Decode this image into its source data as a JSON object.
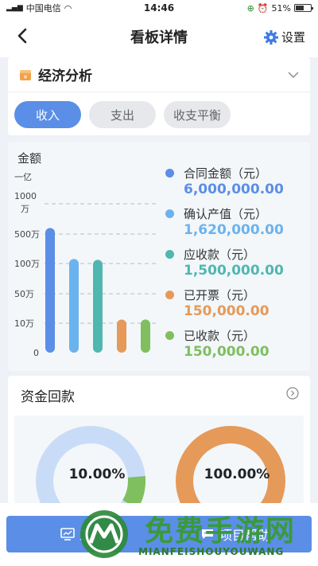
{
  "status": {
    "carrier": "中国电信",
    "time": "14:46",
    "battery": "51%"
  },
  "nav": {
    "title": "看板详情",
    "settings_label": "设置"
  },
  "economic": {
    "title": "经济分析",
    "tabs": [
      {
        "label": "收入",
        "active": true
      },
      {
        "label": "支出",
        "active": false
      },
      {
        "label": "收支平衡",
        "active": false
      }
    ]
  },
  "chart_data": {
    "type": "bar",
    "ylabel": "金额",
    "y_ticks": [
      "一亿",
      "1000万",
      "500万",
      "100万",
      "50万",
      "10万",
      "0"
    ],
    "categories": [
      "合同金额（元）",
      "确认产值（元）",
      "应收款（元）",
      "已开票（元）",
      "已收款（元）"
    ],
    "values": [
      6000000,
      1620000,
      1500000,
      150000,
      150000
    ],
    "value_labels": [
      "6,000,000.00",
      "1,620,000.00",
      "1,500,000.00",
      "150,000.00",
      "150,000.00"
    ],
    "colors": [
      "#5b8ee6",
      "#6bb3ee",
      "#4fb7b0",
      "#e59a5a",
      "#7fbf5f"
    ],
    "legend": "right"
  },
  "funds": {
    "title": "资金回款",
    "donuts": [
      {
        "label": "10.00%",
        "fraction": 0.1,
        "main_color": "#c9dcf7",
        "accent_color": "#7fbf5f"
      },
      {
        "label": "100.00%",
        "fraction": 1.0,
        "main_color": "#e59a5a",
        "accent_color": "#e59a5a"
      }
    ]
  },
  "bottom": {
    "left_label": "工作",
    "right_label": "项目帮助"
  },
  "watermark": {
    "text": "免费手游网",
    "sub": "MIANFEISHOUYOUWANG"
  }
}
